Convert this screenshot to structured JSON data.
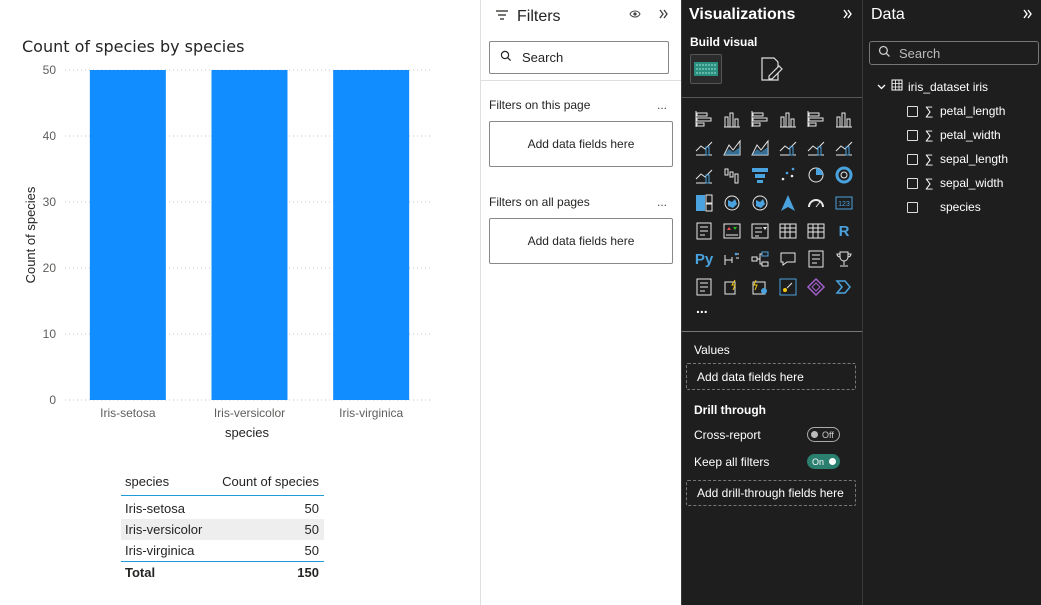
{
  "chart_data": {
    "type": "bar",
    "title": "Count of species by species",
    "xlabel": "species",
    "ylabel": "Count of species",
    "categories": [
      "Iris-setosa",
      "Iris-versicolor",
      "Iris-virginica"
    ],
    "values": [
      50,
      50,
      50
    ],
    "ylim": [
      0,
      50
    ],
    "yticks": [
      "0",
      "10",
      "20",
      "30",
      "40",
      "50"
    ],
    "bar_color": "#118DFF",
    "grid": true,
    "legend": "none"
  },
  "table": {
    "headers": [
      "species",
      "Count of species"
    ],
    "rows": [
      {
        "species": "Iris-setosa",
        "count": "50"
      },
      {
        "species": "Iris-versicolor",
        "count": "50"
      },
      {
        "species": "Iris-virginica",
        "count": "50"
      }
    ],
    "total_label": "Total",
    "total_value": "150",
    "accent": "#1F9BD7"
  },
  "filters": {
    "title": "Filters",
    "search_placeholder": "Search",
    "sections": [
      {
        "title": "Filters on this page",
        "well": "Add data fields here"
      },
      {
        "title": "Filters on all pages",
        "well": "Add data fields here"
      }
    ],
    "more": "..."
  },
  "visualizations": {
    "title": "Visualizations",
    "build_visual": "Build visual",
    "icons": [
      "stacked-bar-icon",
      "stacked-column-icon",
      "clustered-bar-icon",
      "clustered-column-icon",
      "100-stacked-bar-icon",
      "100-stacked-column-icon",
      "line-chart-icon",
      "area-chart-icon",
      "stacked-area-icon",
      "ribbon-chart-icon",
      "line-clustered-column-icon",
      "line-stacked-column-icon",
      "line-and-column-icon",
      "waterfall-icon",
      "funnel-icon",
      "scatter-icon",
      "pie-chart-icon",
      "donut-chart-icon",
      "treemap-icon",
      "map-icon",
      "filled-map-icon",
      "azure-map-icon",
      "gauge-icon",
      "card-icon",
      "multi-row-card-icon",
      "kpi-icon",
      "slicer-icon",
      "table-icon",
      "matrix-icon",
      "r-visual-icon",
      "python-visual-icon",
      "key-influencers-icon",
      "decomposition-tree-icon",
      "qa-icon",
      "narrative-icon",
      "goals-icon",
      "paginated-report-icon",
      "power-apps-icon",
      "power-automate-icon",
      "arcgis-icon",
      "diamond-visual-icon",
      "chevron-visual-icon"
    ],
    "more": "...",
    "values_label": "Values",
    "values_well": "Add data fields here",
    "drill_through": "Drill through",
    "cross_report": "Cross-report",
    "cross_report_state": "Off",
    "keep_all_filters": "Keep all filters",
    "keep_all_filters_state": "On",
    "drill_well": "Add drill-through fields here"
  },
  "data_pane": {
    "title": "Data",
    "search_placeholder": "Search",
    "table_name": "iris_dataset iris",
    "fields": [
      {
        "name": "petal_length",
        "sigma": "∑"
      },
      {
        "name": "petal_width",
        "sigma": "∑"
      },
      {
        "name": "sepal_length",
        "sigma": "∑"
      },
      {
        "name": "sepal_width",
        "sigma": "∑"
      },
      {
        "name": "species",
        "sigma": ""
      }
    ]
  }
}
